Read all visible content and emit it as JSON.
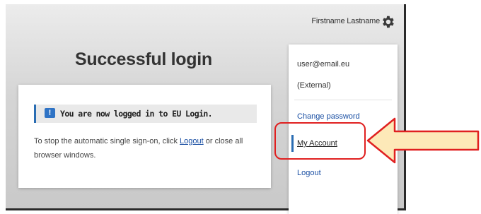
{
  "header": {
    "user_name": "Firstname Lastname",
    "gear_icon": "gear-icon"
  },
  "main": {
    "title": "Successful login",
    "notice": "You are now logged in to EU Login.",
    "notice_icon": "info-icon",
    "message_prefix": "To stop the automatic single sign-on, click ",
    "message_link": "Logout",
    "message_suffix": " or close all browser windows."
  },
  "dropdown": {
    "email": "user@email.eu",
    "account_type": "(External)",
    "change_password": "Change password",
    "my_account": "My Account",
    "logout": "Logout"
  },
  "annotation": {
    "highlight_color": "#e02020",
    "arrow_fill": "#fde9b8"
  }
}
